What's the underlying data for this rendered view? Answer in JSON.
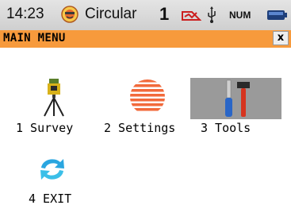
{
  "status_bar": {
    "time": "14:23",
    "mode": "Circular",
    "count": "1",
    "num_indicator": "NUM",
    "icons": [
      "face-icon",
      "signal-icon",
      "usb-icon",
      "battery-icon"
    ]
  },
  "title_bar": {
    "title": "MAIN MENU",
    "close_label": "x",
    "color": "#f79a3c"
  },
  "menu": {
    "items": [
      {
        "label": "1 Survey",
        "icon": "survey-instrument-icon"
      },
      {
        "label": "2 Settings",
        "icon": "settings-sphere-icon"
      },
      {
        "label": "3 Tools",
        "icon": "tools-icon",
        "selected": true
      },
      {
        "label": "4 EXIT",
        "icon": "exit-icon"
      }
    ],
    "selected_color": "#9a9a9a"
  }
}
